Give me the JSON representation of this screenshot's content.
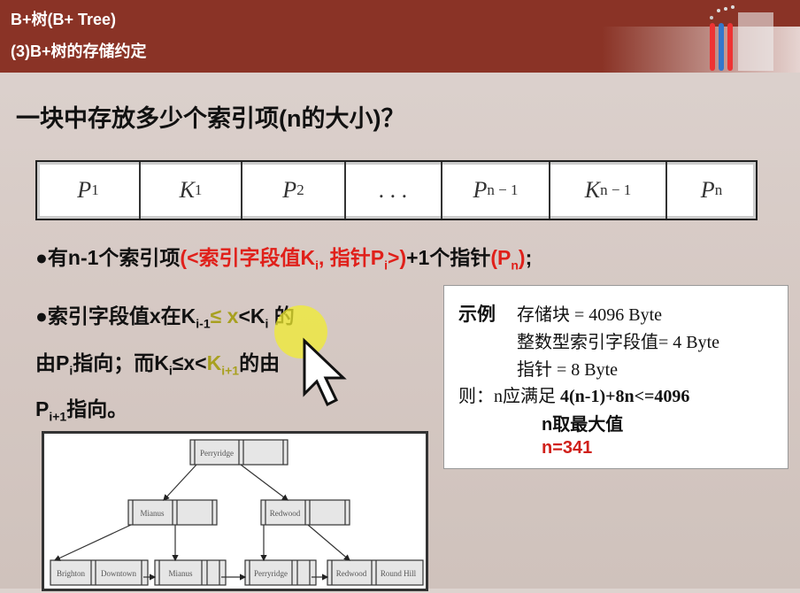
{
  "header": {
    "course_title": "B+树(B+ Tree)",
    "section_title": "(3)B+树的存储约定"
  },
  "slide_title": "一块中存放多少个索引项(n的大小)？",
  "node_cells": [
    {
      "base": "P",
      "sub": "1"
    },
    {
      "base": "K",
      "sub": "1"
    },
    {
      "base": "P",
      "sub": "2"
    },
    {
      "base": ". . .",
      "sub": ""
    },
    {
      "base": "P",
      "sub": "n − 1"
    },
    {
      "base": "K",
      "sub": "n − 1"
    },
    {
      "base": "P",
      "sub": "n"
    }
  ],
  "bullet1": {
    "prefix": "●有n-1个索引项",
    "red1": "(<索引字段值K",
    "sub_i": "i",
    "red2": ", 指针P",
    "sub_i2": "i",
    "red3": ">)",
    "mid": "+1个指针",
    "red4": "(P",
    "sub_n": "n",
    "red5": ")",
    "end": ";"
  },
  "bullet2": {
    "p1": "●索引字段值x在K",
    "s1": "i-1",
    "p2": "≤ x",
    "p3": "<K",
    "s2": "i",
    "p4": " 的",
    "p5": "由P",
    "s3": "i",
    "p6": "指向；而K",
    "s4": "i",
    "p7": "≤x<",
    "p8": "K",
    "s5": "i+1",
    "p9": "的由",
    "p10": "P",
    "s6": "i+1",
    "p11": "指向。"
  },
  "example": {
    "label": "示例",
    "line1": "存储块 = 4096 Byte",
    "line2": "整数型索引字段值= 4 Byte",
    "line3": "指针 = 8 Byte",
    "line4_prefix": "则：n应满足 ",
    "line4_formula": "4(n-1)+8n<=4096",
    "line5": "n取最大值",
    "line6": "n=341"
  },
  "tree": {
    "root": [
      "Perryridge"
    ],
    "internal": [
      [
        "Mianus"
      ],
      [
        "Redwood"
      ]
    ],
    "leaves": [
      [
        "Brighton",
        "Downtown"
      ],
      [
        "Mianus"
      ],
      [
        "Perryridge"
      ],
      [
        "Redwood",
        "Round Hill"
      ]
    ]
  },
  "colors": {
    "header": "#8a3326",
    "highlight_red": "#e0201a"
  }
}
